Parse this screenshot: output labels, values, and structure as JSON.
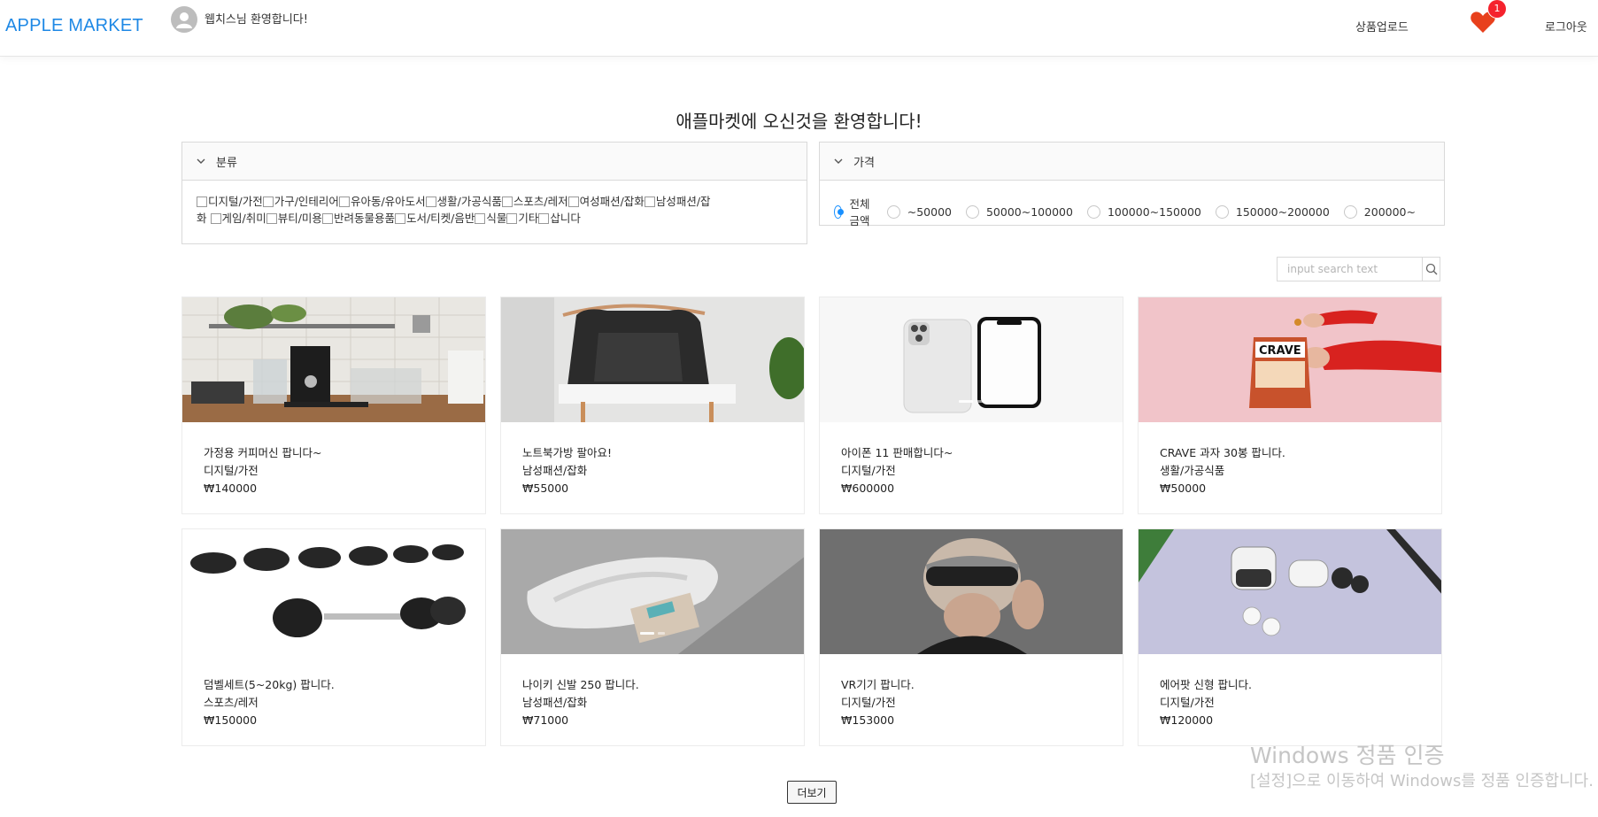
{
  "header": {
    "logo": "APPLE MARKET",
    "welcome": "웹치스님 환영합니다!",
    "upload": "상품업로드",
    "cart_count": "1",
    "logout": "로그아웃",
    "accent": "#1e88e5"
  },
  "main": {
    "title": "애플마켓에 오신것을 환영합니다!"
  },
  "category_panel": {
    "title": "분류",
    "line1": [
      "디지털/가전",
      "가구/인테리어",
      "유아동/유아도서",
      "생활/가공식품",
      "스포츠/레저",
      "여성패션/잡화",
      "남성패션/잡"
    ],
    "line2_prefix": "화",
    "line2": [
      "게임/취미",
      "뷰티/미용",
      "반려동물용품",
      "도서/티켓/음반",
      "식물",
      "기타",
      "삽니다"
    ]
  },
  "price_panel": {
    "title": "가격",
    "options": [
      "전체금액",
      "~50000",
      "50000~100000",
      "100000~150000",
      "150000~200000",
      "200000~"
    ],
    "selected": "전체금액"
  },
  "search": {
    "placeholder": "input search text"
  },
  "products": [
    {
      "title": "가정용 커피머신 팝니다~",
      "category": "디지털/가전",
      "price": "₩140000"
    },
    {
      "title": "노트북가방 팔아요!",
      "category": "남성패션/잡화",
      "price": "₩55000"
    },
    {
      "title": "아이폰 11 판매합니다~",
      "category": "디지털/가전",
      "price": "₩600000"
    },
    {
      "title": "CRAVE 과자 30봉 팝니다.",
      "category": "생활/가공식품",
      "price": "₩50000"
    },
    {
      "title": "덤벨세트(5~20kg) 팝니다.",
      "category": "스포츠/레저",
      "price": "₩150000"
    },
    {
      "title": "나이키 신발 250 팝니다.",
      "category": "남성패션/잡화",
      "price": "₩71000"
    },
    {
      "title": "VR기기 팝니다.",
      "category": "디지털/가전",
      "price": "₩153000"
    },
    {
      "title": "에어팟 신형 팝니다.",
      "category": "디지털/가전",
      "price": "₩120000"
    }
  ],
  "more_button": "더보기",
  "watermark": {
    "line1": "Windows 정품 인증",
    "line2": "[설정]으로 이동하여 Windows를 정품 인증합니다."
  }
}
